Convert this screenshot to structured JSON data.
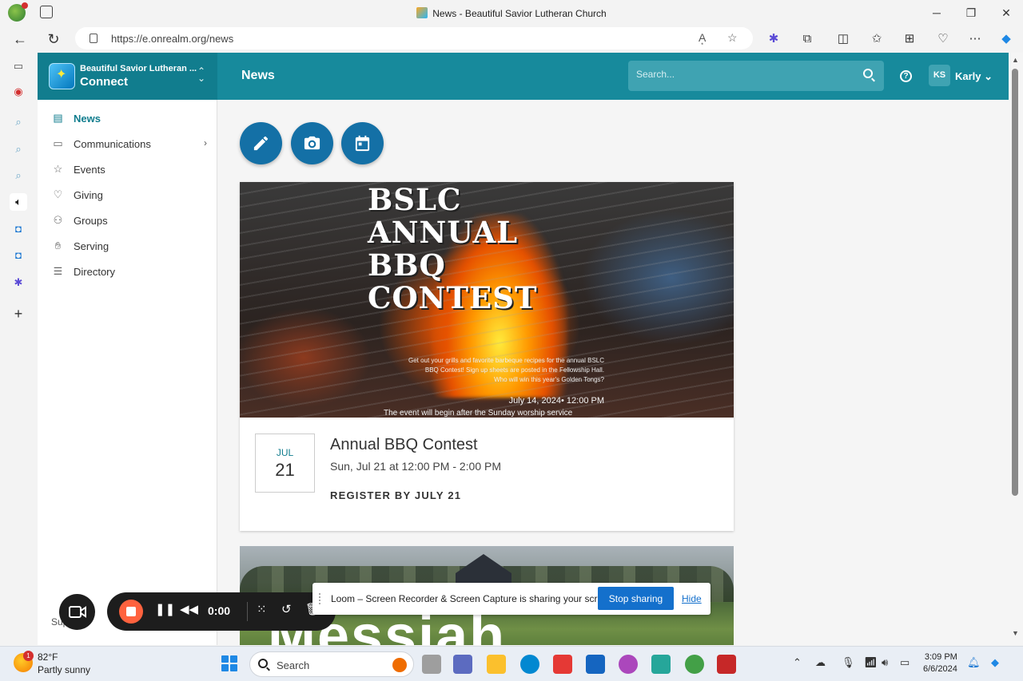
{
  "browser": {
    "window_title": "News - Beautiful Savior Lutheran Church",
    "url": "https://e.onrealm.org/news"
  },
  "app": {
    "org_name": "Beautiful Savior Lutheran ...",
    "app_name": "Connect",
    "page_title": "News",
    "search_placeholder": "Search...",
    "user_initials": "KS",
    "user_name": "Karly"
  },
  "nav": {
    "items": [
      {
        "label": "News",
        "icon": "news-icon",
        "active": true
      },
      {
        "label": "Communications",
        "icon": "chat-icon",
        "has_submenu": true
      },
      {
        "label": "Events",
        "icon": "calendar-star-icon"
      },
      {
        "label": "Giving",
        "icon": "hand-heart-icon"
      },
      {
        "label": "Groups",
        "icon": "people-icon"
      },
      {
        "label": "Serving",
        "icon": "hand-icon"
      },
      {
        "label": "Directory",
        "icon": "directory-icon"
      }
    ],
    "support_label": "Support"
  },
  "actions": [
    {
      "name": "write-post",
      "icon": "pencil-icon"
    },
    {
      "name": "add-photo",
      "icon": "camera-icon"
    },
    {
      "name": "add-event",
      "icon": "calendar-icon"
    }
  ],
  "event_card": {
    "hero": {
      "headline_lines": [
        "BSLC",
        "ANNUAL",
        "BBQ",
        "CONTEST"
      ],
      "blurb_lines": [
        "Get out your grills and favorite barbeque recipes for the annual BSLC",
        "BBQ Contest!  Sign up sheets are posted in the Fellowship Hall.",
        "Who will win this year's Golden Tongs?"
      ],
      "datetime": "July 14, 2024•   12:00 PM",
      "note": "The event will begin after the Sunday worship service"
    },
    "month": "JUL",
    "day": "21",
    "title": "Annual BBQ Contest",
    "time": "Sun, Jul 21 at 12:00 PM - 2:00 PM",
    "register": "REGISTER BY JULY 21"
  },
  "second_card": {
    "big_text": "Messiah"
  },
  "loom": {
    "timer": "0:00",
    "share_message": "Loom – Screen Recorder & Screen Capture is sharing your screen.",
    "stop_label": "Stop sharing",
    "hide_label": "Hide"
  },
  "taskbar": {
    "temp": "82°F",
    "condition": "Partly sunny",
    "weather_badge": "1",
    "search_label": "Search",
    "time": "3:09 PM",
    "date": "6/6/2024"
  },
  "colors": {
    "brand_teal": "#178a9c",
    "brand_dark": "#117d8e",
    "action_blue": "#1470a6"
  }
}
